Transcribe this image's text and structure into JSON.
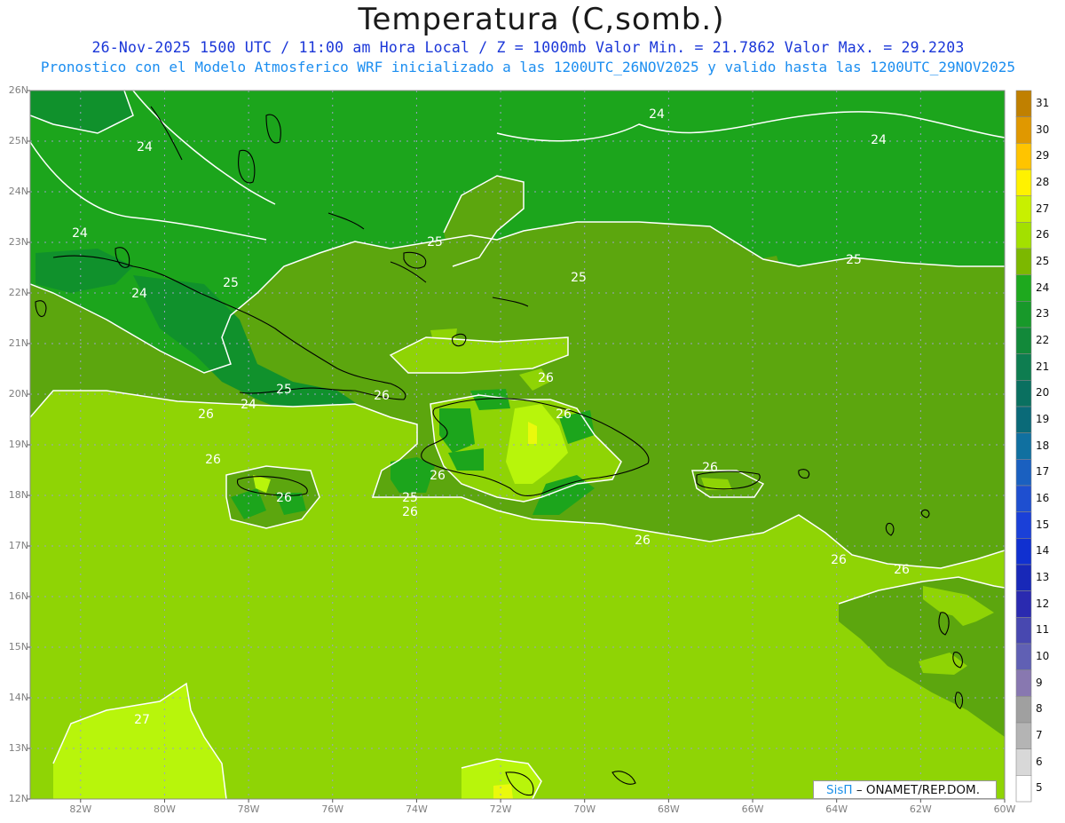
{
  "header": {
    "title": "Temperatura (C,somb.)",
    "line1": "26-Nov-2025 1500 UTC / 11:00 am Hora Local / Z = 1000mb  Valor Min. = 21.7862  Valor Max. = 29.2203",
    "line2": "Pronostico con el Modelo Atmosferico WRF inicializado a las 1200UTC_26NOV2025 y valido hasta las  1200UTC_29NOV2025"
  },
  "map": {
    "lat_labels": [
      "26N",
      "25N",
      "24N",
      "23N",
      "22N",
      "21N",
      "20N",
      "19N",
      "18N",
      "17N",
      "16N",
      "15N",
      "14N",
      "13N",
      "12N"
    ],
    "lon_labels": [
      "82W",
      "80W",
      "78W",
      "76W",
      "74W",
      "72W",
      "70W",
      "68W",
      "66W",
      "64W",
      "62W",
      "60W"
    ],
    "lat_range": [
      12,
      26
    ],
    "lon_range": [
      -83.2,
      -60
    ],
    "grid": true,
    "contour_labels": [
      "24",
      "24",
      "24",
      "24",
      "24",
      "25",
      "25",
      "25",
      "25",
      "25",
      "25",
      "26",
      "26",
      "26",
      "26",
      "26",
      "26",
      "26",
      "26",
      "26",
      "26",
      "27"
    ],
    "colors": {
      "t24": "#1ca51c",
      "t25": "#5ca60e",
      "t26": "#8fd405",
      "t27": "#b8f50b",
      "t23": "#10912c",
      "t28": "#eaf90c",
      "land_outline": "#000000",
      "contour": "#ffffff"
    }
  },
  "colorbar": {
    "labels": [
      "31",
      "30",
      "29",
      "28",
      "27",
      "26",
      "25",
      "24",
      "23",
      "22",
      "21",
      "20",
      "19",
      "18",
      "17",
      "16",
      "15",
      "14",
      "13",
      "12",
      "11",
      "10",
      "9",
      "8",
      "7",
      "6",
      "5"
    ],
    "colors": [
      "#c08000",
      "#e09800",
      "#ffc400",
      "#fff200",
      "#c8f000",
      "#a3e000",
      "#7cb800",
      "#1ea91e",
      "#18992a",
      "#12893a",
      "#0e7d50",
      "#0a7060",
      "#0a6a78",
      "#1070a0",
      "#1a60c0",
      "#1e4fd0",
      "#1a40d8",
      "#1030d0",
      "#1828b8",
      "#2a2ab0",
      "#4848b0",
      "#6060b4",
      "#8878b0",
      "#a0a0a0",
      "#b4b4b4",
      "#d8d8d8",
      "#ffffff"
    ]
  },
  "credit": {
    "brand": "SisΠ",
    "rest": "– ONAMET/REP.DOM."
  }
}
